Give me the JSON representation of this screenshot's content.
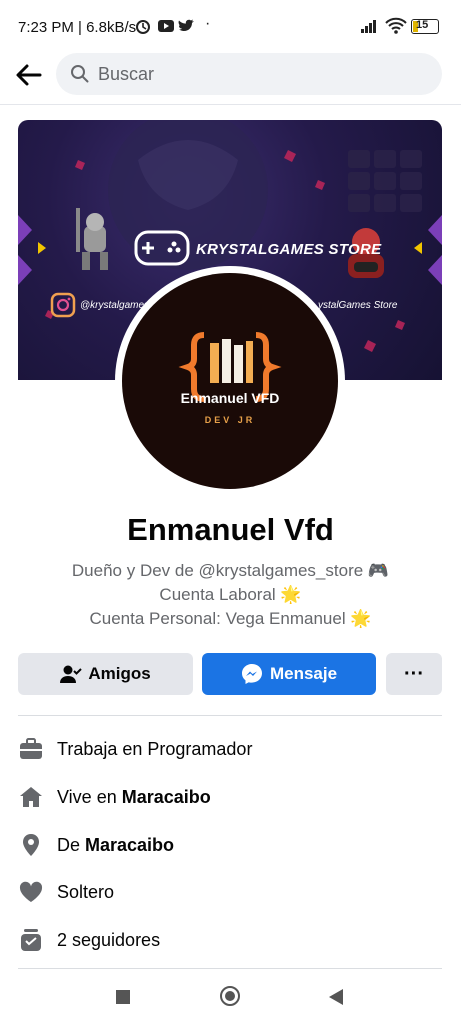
{
  "status_bar": {
    "time": "7:23 PM | 6.8kB/s",
    "battery": "15"
  },
  "search": {
    "placeholder": "Buscar"
  },
  "cover": {
    "store_name": "KRYSTALGAMES STORE",
    "instagram": "@krystalgames",
    "facebook": "ystalGames Store"
  },
  "avatar": {
    "name": "Enmanuel VFD",
    "subtitle": "DEV JR"
  },
  "profile": {
    "name": "Enmanuel Vfd",
    "bio_line1": "Dueño y Dev de @krystalgames_store 🎮",
    "bio_line2": "Cuenta Laboral 🌟",
    "bio_line3": "Cuenta Personal: Vega Enmanuel 🌟"
  },
  "actions": {
    "friends": "Amigos",
    "message": "Mensaje",
    "more": "···"
  },
  "details": {
    "work": "Trabaja en Programador",
    "lives_prefix": "Vive en ",
    "lives_city": "Maracaibo",
    "from_prefix": "De ",
    "from_city": "Maracaibo",
    "relationship": "Soltero",
    "followers": "2 seguidores"
  },
  "colors": {
    "primary": "#1b74e4",
    "secondary_bg": "#e4e6eb",
    "icon": "#65676b"
  }
}
